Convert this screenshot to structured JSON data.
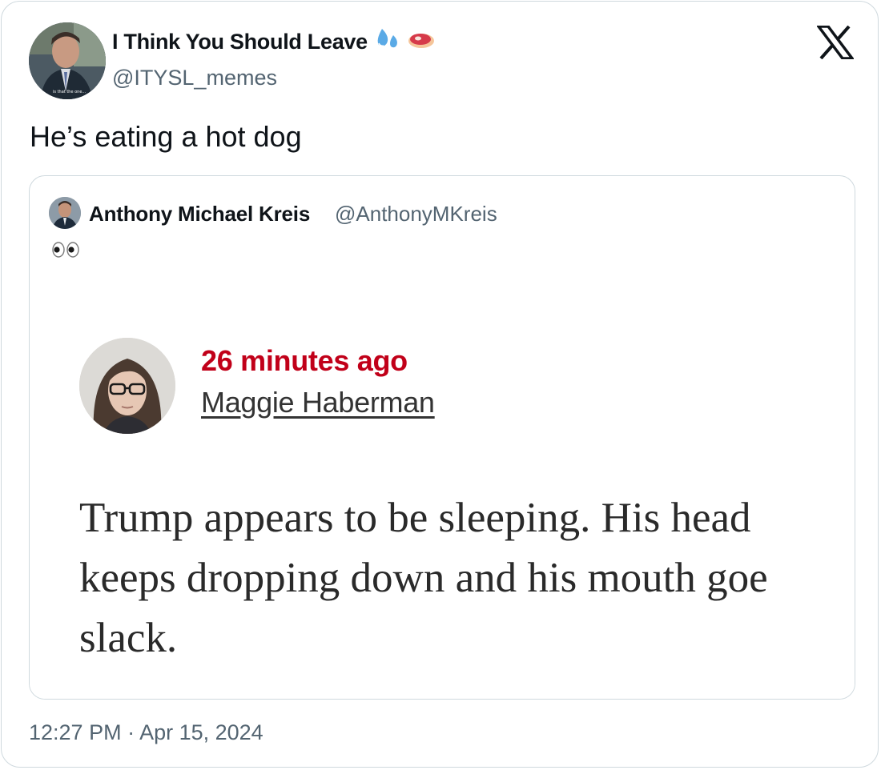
{
  "author": {
    "display_name": "I Think You Should Leave",
    "handle": "@ITYSL_memes",
    "name_emojis": [
      "sweat-droplets-emoji",
      "meat-emoji"
    ],
    "avatar_caption": "is that the one..."
  },
  "tweet": {
    "text": "He’s eating a hot dog",
    "timestamp": "12:27 PM · Apr 15, 2024"
  },
  "quoted_tweet": {
    "display_name": "Anthony Michael Kreis",
    "handle": "@AnthonyMKreis",
    "text": "👀",
    "screenshot": {
      "time": "26 minutes ago",
      "author": "Maggie Haberman",
      "body_lines": [
        "Trump appears to be sleeping. His head",
        "keeps dropping down and his mouth goe",
        "slack."
      ]
    }
  },
  "colors": {
    "text_primary": "#0f1419",
    "text_secondary": "#536471",
    "border": "#cfd9de",
    "time_red": "#c10019"
  },
  "icons": {
    "brand": "x-logo-icon"
  }
}
